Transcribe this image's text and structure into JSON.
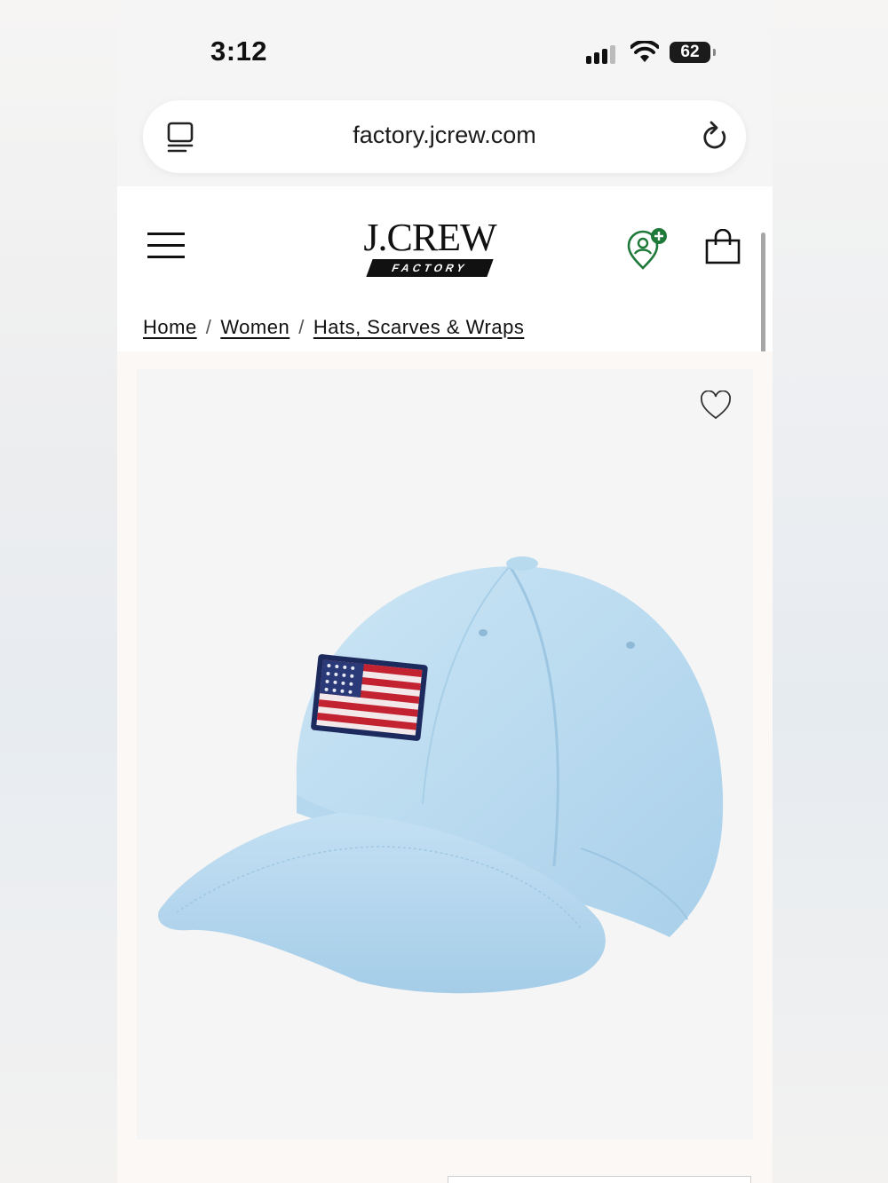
{
  "status_bar": {
    "time": "3:12",
    "battery": "62"
  },
  "browser": {
    "url": "factory.jcrew.com"
  },
  "header": {
    "logo_main": "J.CREW",
    "logo_sub": "FACTORY",
    "icons": [
      "menu-icon",
      "rewards-icon",
      "bag-icon"
    ]
  },
  "breadcrumb": {
    "items": [
      "Home",
      "Women",
      "Hats, Scarves & Wraps"
    ],
    "separator": "/"
  },
  "product": {
    "image_description_icon": "heart-icon"
  },
  "colors": {
    "accent_green": "#1f7a3a",
    "cap_blue": "#bcdcf0"
  }
}
